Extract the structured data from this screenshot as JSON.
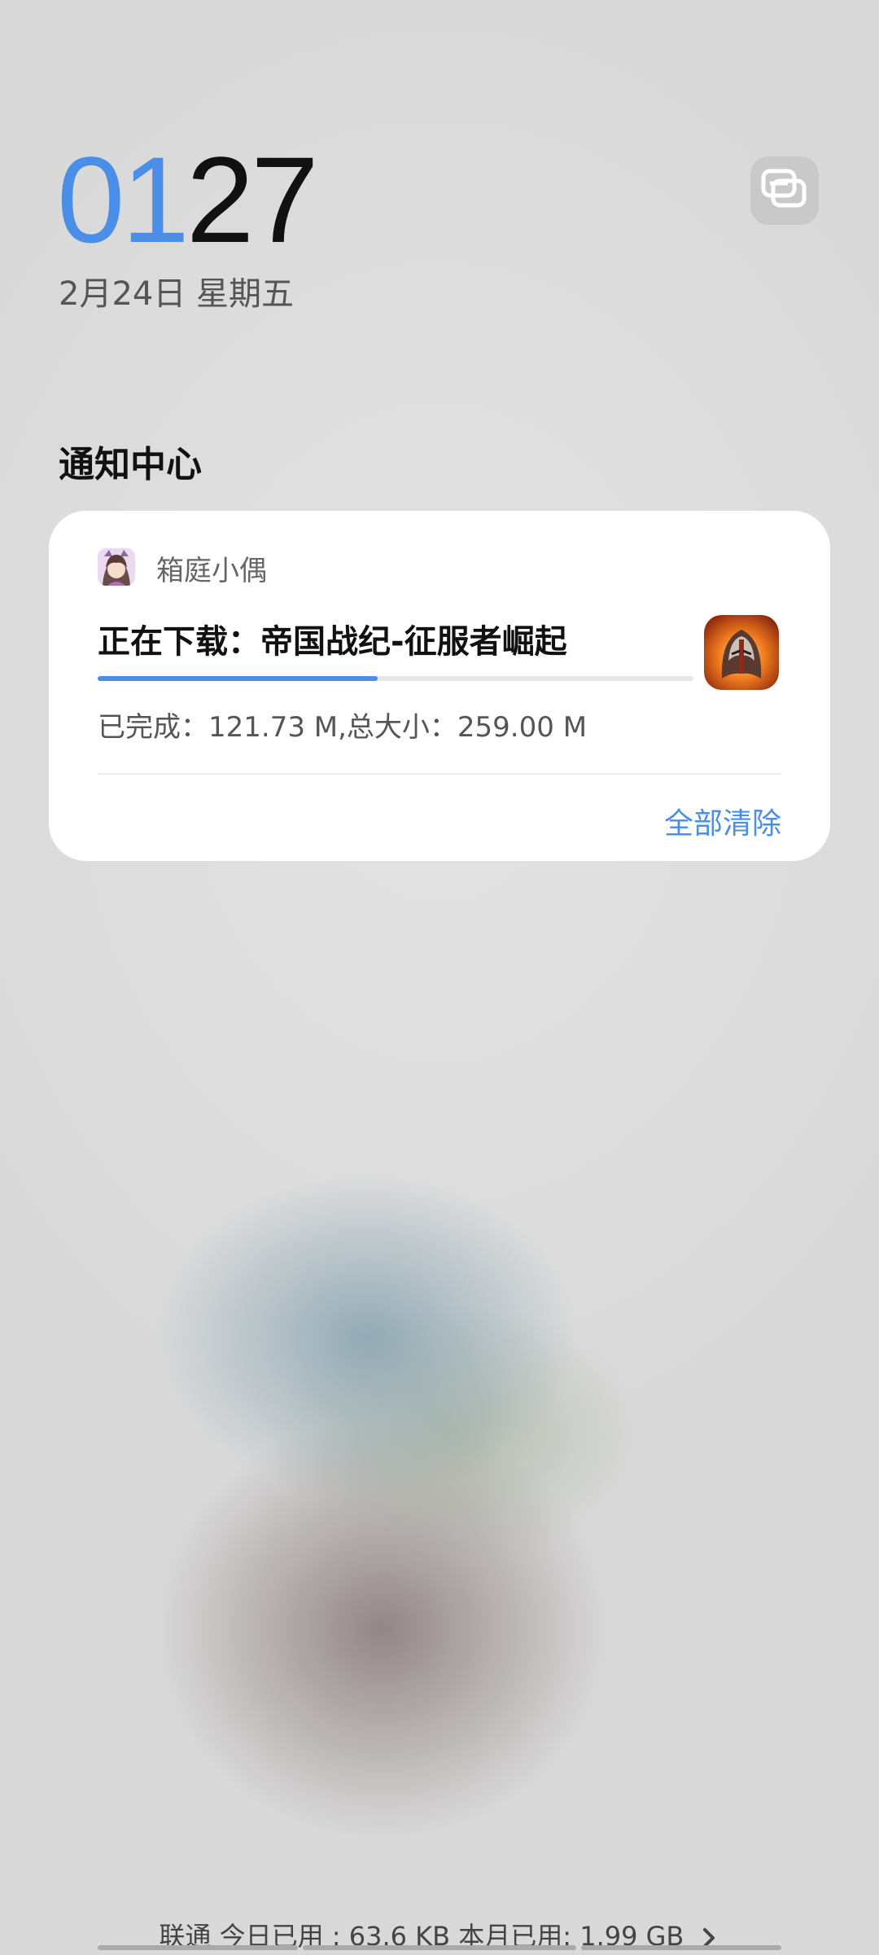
{
  "clock": {
    "hours": "01",
    "minutes": "27"
  },
  "date": "2月24日 星期五",
  "switch_icon": "screen-switch-icon",
  "notification_center": {
    "title": "通知中心"
  },
  "notification": {
    "app_icon": "app-avatar-icon",
    "app_name": "箱庭小偶",
    "title": "正在下载：帝国战纪-征服者崛起",
    "thumbnail": "game-thumbnail",
    "progress": 0.47,
    "text": "已完成：121.73 M,总大小：259.00 M",
    "clear_all_label": "全部清除"
  },
  "data_usage": {
    "text": "联通 今日已用 : 63.6 KB 本月已用: 1.99 GB",
    "chevron_icon": "chevron-right-icon"
  },
  "colors": {
    "accent": "#4a8ee8",
    "background": "#d9d9d9",
    "card": "#ffffff"
  }
}
